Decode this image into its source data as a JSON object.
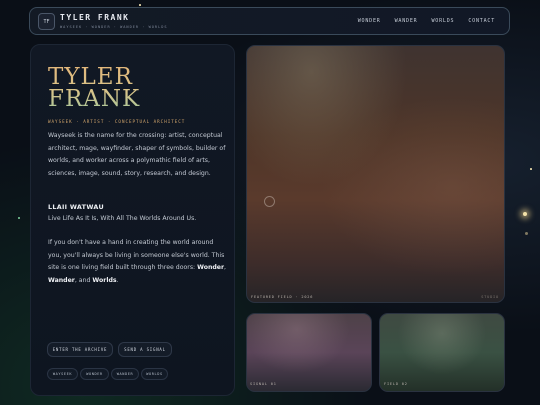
{
  "header": {
    "logo_text": "TF",
    "brand": "TYLER FRANK",
    "brand_sub": "WAYSEEK · WONDER · WANDER · WORLDS",
    "nav": [
      "WONDER",
      "WANDER",
      "WORLDS",
      "CONTACT"
    ]
  },
  "intro": {
    "name_line1": "TYLER",
    "name_line2": "FRANK",
    "subtitle": "WAYSEEK · ARTIST · CONCEPTUAL ARCHITECT",
    "paragraph1": "Wayseek is the name for the crossing: artist, conceptual architect, mage, wayfinder, shaper of symbols, builder of worlds, and worker across a polymathic field of arts, sciences, image, sound, story, research, and design.",
    "motto_title": "LLAII WATWAU",
    "motto": "Live Life As It Is, With All The Worlds Around Us.",
    "paragraph2_a": "If you don't have a hand in creating the world around you, you'll always be living in someone else's world. This site is one living field built through three doors: ",
    "paragraph2_wonder": "Wonder",
    "paragraph2_sep1": ", ",
    "paragraph2_wander": "Wander",
    "paragraph2_sep2": ", and ",
    "paragraph2_worlds": "Worlds",
    "paragraph2_end": ".",
    "buttons": {
      "enter": "ENTER THE ARCHIVE",
      "signal": "SEND A SIGNAL"
    },
    "tags": [
      "WAYSEEK",
      "WONDER",
      "WANDER",
      "WORLDS"
    ]
  },
  "cards": {
    "main_label": "FEATURED FIELD · 2026",
    "main_tag": "STUDIO",
    "signal_label": "SIGNAL 01",
    "field_label": "FIELD 02"
  },
  "colors": {
    "accent": "#d9b27a",
    "background": "#0a0f17"
  }
}
